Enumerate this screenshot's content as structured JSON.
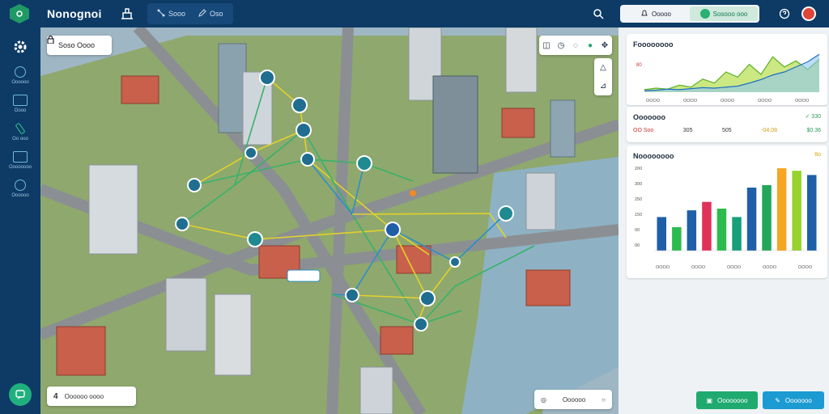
{
  "app": {
    "title": "Nonognoi"
  },
  "toolbar": {
    "tabs": [
      {
        "label": "Sooo",
        "icon": "network-icon"
      },
      {
        "label": "Oso",
        "icon": "pencil-icon"
      }
    ]
  },
  "view_switch": {
    "options": [
      "Ooooo",
      "Sosooo ooo"
    ],
    "active_index": 1
  },
  "sidebar": {
    "items": [
      {
        "label": "Oooooo",
        "icon": "globe-icon"
      },
      {
        "label": "Oooo",
        "icon": "monitor-icon"
      },
      {
        "label": "Oo ooo",
        "icon": "pen-icon"
      },
      {
        "label": "Oooooooo",
        "icon": "layers-icon"
      },
      {
        "label": "Oooooo",
        "icon": "clock-icon"
      }
    ]
  },
  "map": {
    "search_chip": {
      "label": "Soso Oooo",
      "icon": "lock-icon"
    },
    "scale_chip": {
      "value": "4",
      "label": "Oooooo oooo"
    },
    "legend_chip": {
      "label": "Oooooo"
    }
  },
  "panels": {
    "trend": {
      "title": "Foooooooo",
      "axis_label": "80",
      "x_ticks": [
        "OOOO",
        "OOOO",
        "OOOO",
        "OOOO",
        "OOOO"
      ]
    },
    "stats": {
      "title": "Ooooooo",
      "badge": "✓ 330",
      "row": [
        "OO Soo",
        "305",
        "505",
        "-04.08",
        "$0.36"
      ]
    },
    "bars": {
      "title": "Noooooooo",
      "badge": "8o",
      "y_ticks": [
        "200",
        "300",
        "250",
        "150",
        "00",
        "00"
      ],
      "x_labels": [
        "OOOO",
        "OOOO",
        "OOOO",
        "OOOO",
        "OOOO"
      ]
    }
  },
  "buttons": {
    "primary": "Oooooooo",
    "secondary": "Ooooooo"
  },
  "chart_data": [
    {
      "type": "area",
      "title": "Foooooooo",
      "series": [
        {
          "values": [
            5,
            8,
            6,
            14,
            10,
            26,
            18,
            40,
            30,
            55,
            35,
            70,
            50,
            62,
            45,
            65
          ]
        },
        {
          "values": [
            3,
            4,
            6,
            5,
            7,
            9,
            8,
            10,
            12,
            18,
            25,
            34,
            40,
            50,
            60,
            75
          ]
        }
      ]
    },
    {
      "type": "bar",
      "title": "Noooooooo",
      "categories": [
        "OOOO",
        "OOOO",
        "OOOO",
        "OOOO",
        "OOOO",
        "OOOO",
        "OOOO",
        "OOOO",
        "OOOO",
        "OOOO",
        "OOOO"
      ],
      "values": [
        40,
        28,
        48,
        58,
        50,
        40,
        75,
        78,
        98,
        95,
        90
      ],
      "colors": [
        "#1f5fa8",
        "#2bbb4f",
        "#1f5fa8",
        "#e03158",
        "#2bbb4f",
        "#17a07a",
        "#1f5fa8",
        "#22a75a",
        "#f5a623",
        "#97d32c",
        "#1f5fa8"
      ],
      "ylim": [
        0,
        100
      ]
    }
  ]
}
